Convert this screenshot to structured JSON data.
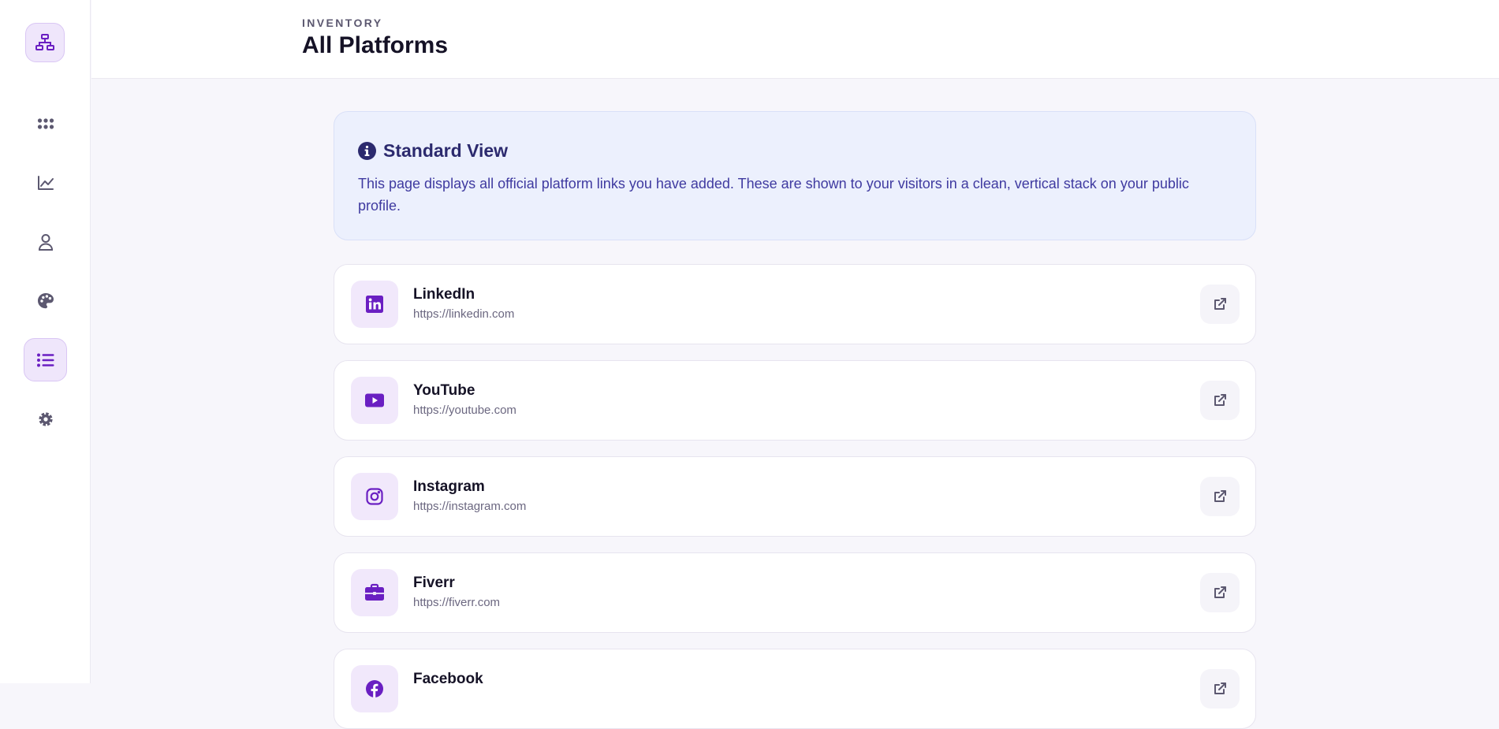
{
  "header": {
    "eyebrow": "INVENTORY",
    "title": "All Platforms"
  },
  "sidebar": {
    "logo_icon": "sitemap-icon",
    "items": [
      {
        "icon": "grid-icon",
        "active": false
      },
      {
        "icon": "chart-line-icon",
        "active": false
      },
      {
        "icon": "user-icon",
        "active": false
      },
      {
        "icon": "palette-icon",
        "active": false
      },
      {
        "icon": "list-icon",
        "active": true
      },
      {
        "icon": "gear-icon",
        "active": false
      }
    ]
  },
  "info": {
    "title": "Standard View",
    "text": "This page displays all official platform links you have added. These are shown to your visitors in a clean, vertical stack on your public profile."
  },
  "platforms": [
    {
      "name": "LinkedIn",
      "url": "https://linkedin.com",
      "icon": "linkedin-icon"
    },
    {
      "name": "YouTube",
      "url": "https://youtube.com",
      "icon": "youtube-icon"
    },
    {
      "name": "Instagram",
      "url": "https://instagram.com",
      "icon": "instagram-icon"
    },
    {
      "name": "Fiverr",
      "url": "https://fiverr.com",
      "icon": "briefcase-icon"
    },
    {
      "name": "Facebook",
      "url": "",
      "icon": "facebook-icon"
    }
  ],
  "colors": {
    "accent": "#6a1fc2",
    "accent_soft": "#efe6fb",
    "info_bg": "#ecf0fd",
    "info_text": "#3f3aa0",
    "muted_icon": "#5c5870"
  }
}
